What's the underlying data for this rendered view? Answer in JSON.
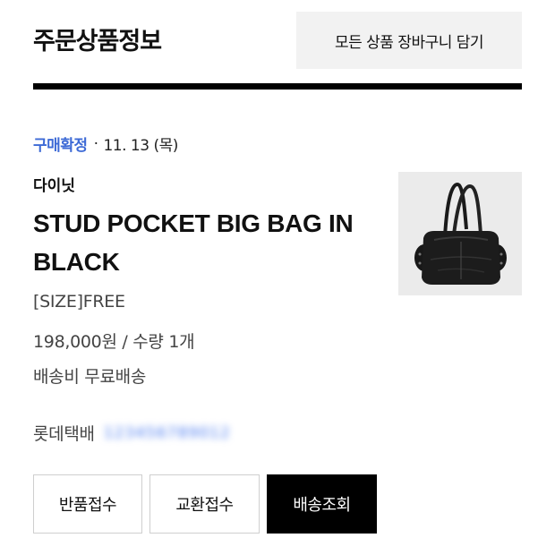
{
  "header": {
    "title": "주문상품정보",
    "cart_all_label": "모든 상품 장바구니 담기"
  },
  "order": {
    "status": "구매확정",
    "separator": "·",
    "date": "11. 13 (목)",
    "brand": "다이닛",
    "product_name": "STUD POCKET BIG BAG IN BLACK",
    "option": "[SIZE]FREE",
    "price_qty": "198,000원 / 수량 1개",
    "shipping": "배송비 무료배송",
    "carrier": "롯데택배",
    "tracking_number": "123456789012",
    "thumbnail_icon": "black-tote-bag-image"
  },
  "actions": {
    "return_label": "반품접수",
    "exchange_label": "교환접수",
    "tracking_label": "배송조회"
  },
  "colors": {
    "status_blue": "#3d6ad6",
    "primary_black": "#000000",
    "thumb_bg": "#ebebeb"
  }
}
